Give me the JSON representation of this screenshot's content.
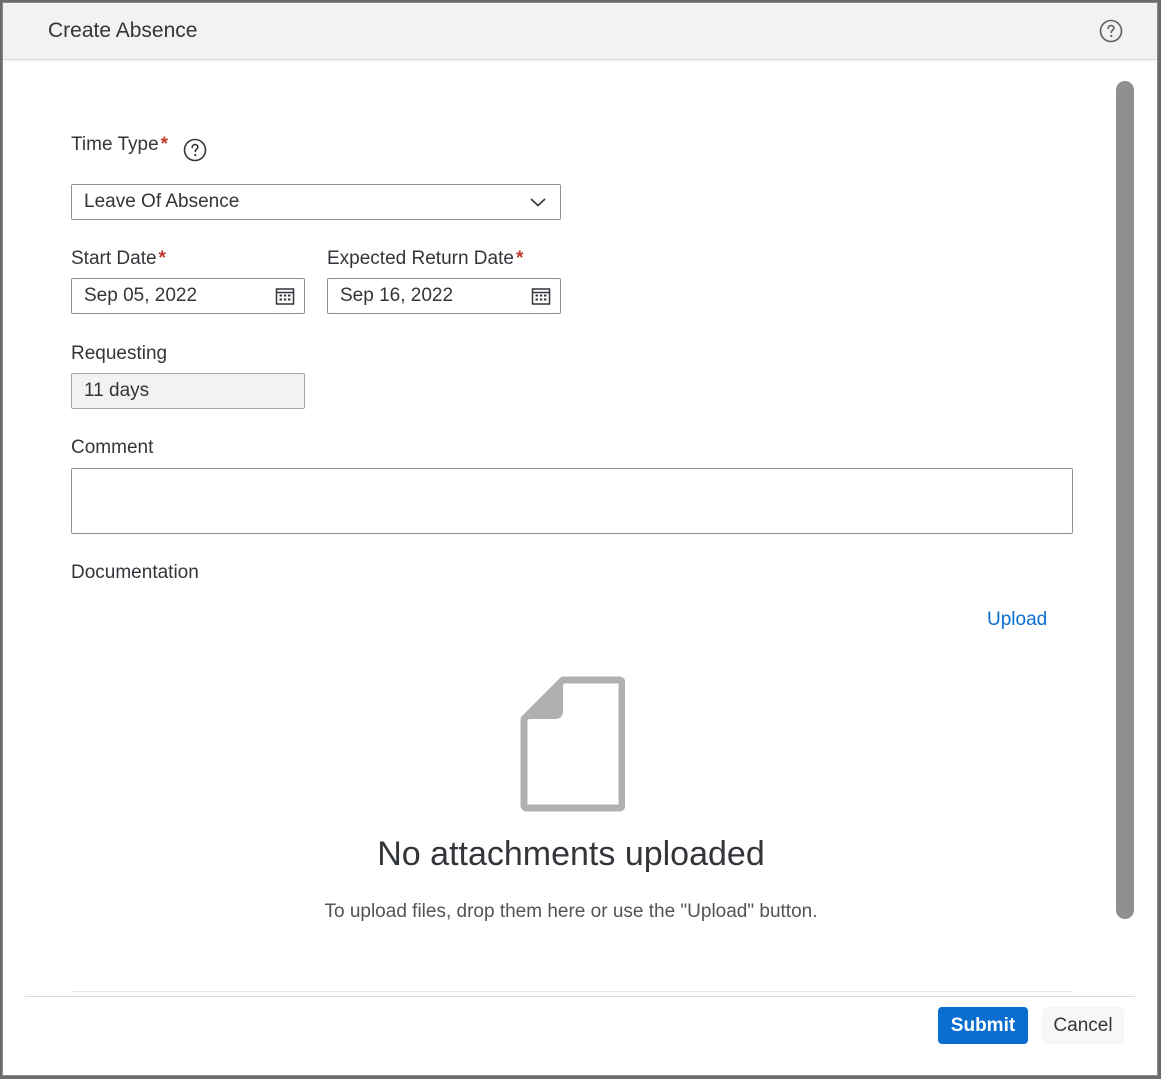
{
  "dialog": {
    "title": "Create Absence",
    "help_icon": "help-circle-icon"
  },
  "form": {
    "time_type": {
      "label": "Time Type",
      "required_marker": "*",
      "info_icon": "help-circle-icon",
      "value": "Leave Of Absence",
      "trail_icon": "chevron-down-icon"
    },
    "start_date": {
      "label": "Start Date",
      "required_marker": "*",
      "value": "Sep 05, 2022",
      "trail_icon": "calendar-icon"
    },
    "return_date": {
      "label": "Expected Return Date",
      "required_marker": "*",
      "value": "Sep 16, 2022",
      "trail_icon": "calendar-icon"
    },
    "requesting": {
      "label": "Requesting",
      "value": "11 days"
    },
    "comment": {
      "label": "Comment",
      "value": ""
    }
  },
  "documentation": {
    "label": "Documentation",
    "upload_link": "Upload",
    "empty_icon": "document-icon",
    "empty_title": "No attachments uploaded",
    "empty_description": "To upload files, drop them here or use the \"Upload\" button."
  },
  "footer": {
    "submit_label": "Submit",
    "cancel_label": "Cancel"
  },
  "colors": {
    "accent": "#0a6ed1",
    "required": "#c0392b",
    "header_bg": "#f2f2f2"
  }
}
